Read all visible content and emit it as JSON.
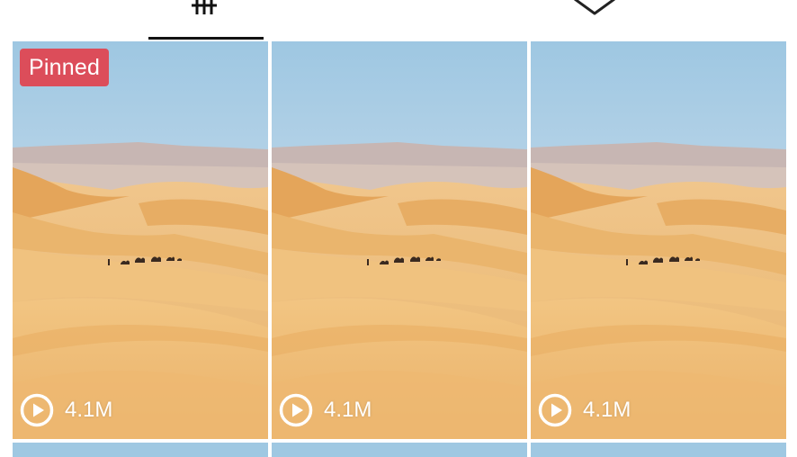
{
  "tabs": [
    {
      "id": "videos",
      "icon": "grid-icon",
      "active": true
    },
    {
      "id": "tagged",
      "icon": "chevron-down-icon",
      "active": false
    }
  ],
  "videos": [
    {
      "pinned_label": "Pinned",
      "views": "4.1M",
      "play_icon": "play-circle-icon"
    },
    {
      "pinned_label": "",
      "views": "4.1M",
      "play_icon": "play-circle-icon"
    },
    {
      "pinned_label": "",
      "views": "4.1M",
      "play_icon": "play-circle-icon"
    }
  ],
  "colors": {
    "pinned_badge": "#dc4d5a",
    "active_tab_underline": "#111111",
    "sky_top": "#9cc8e3",
    "sand": "#e9b063"
  }
}
